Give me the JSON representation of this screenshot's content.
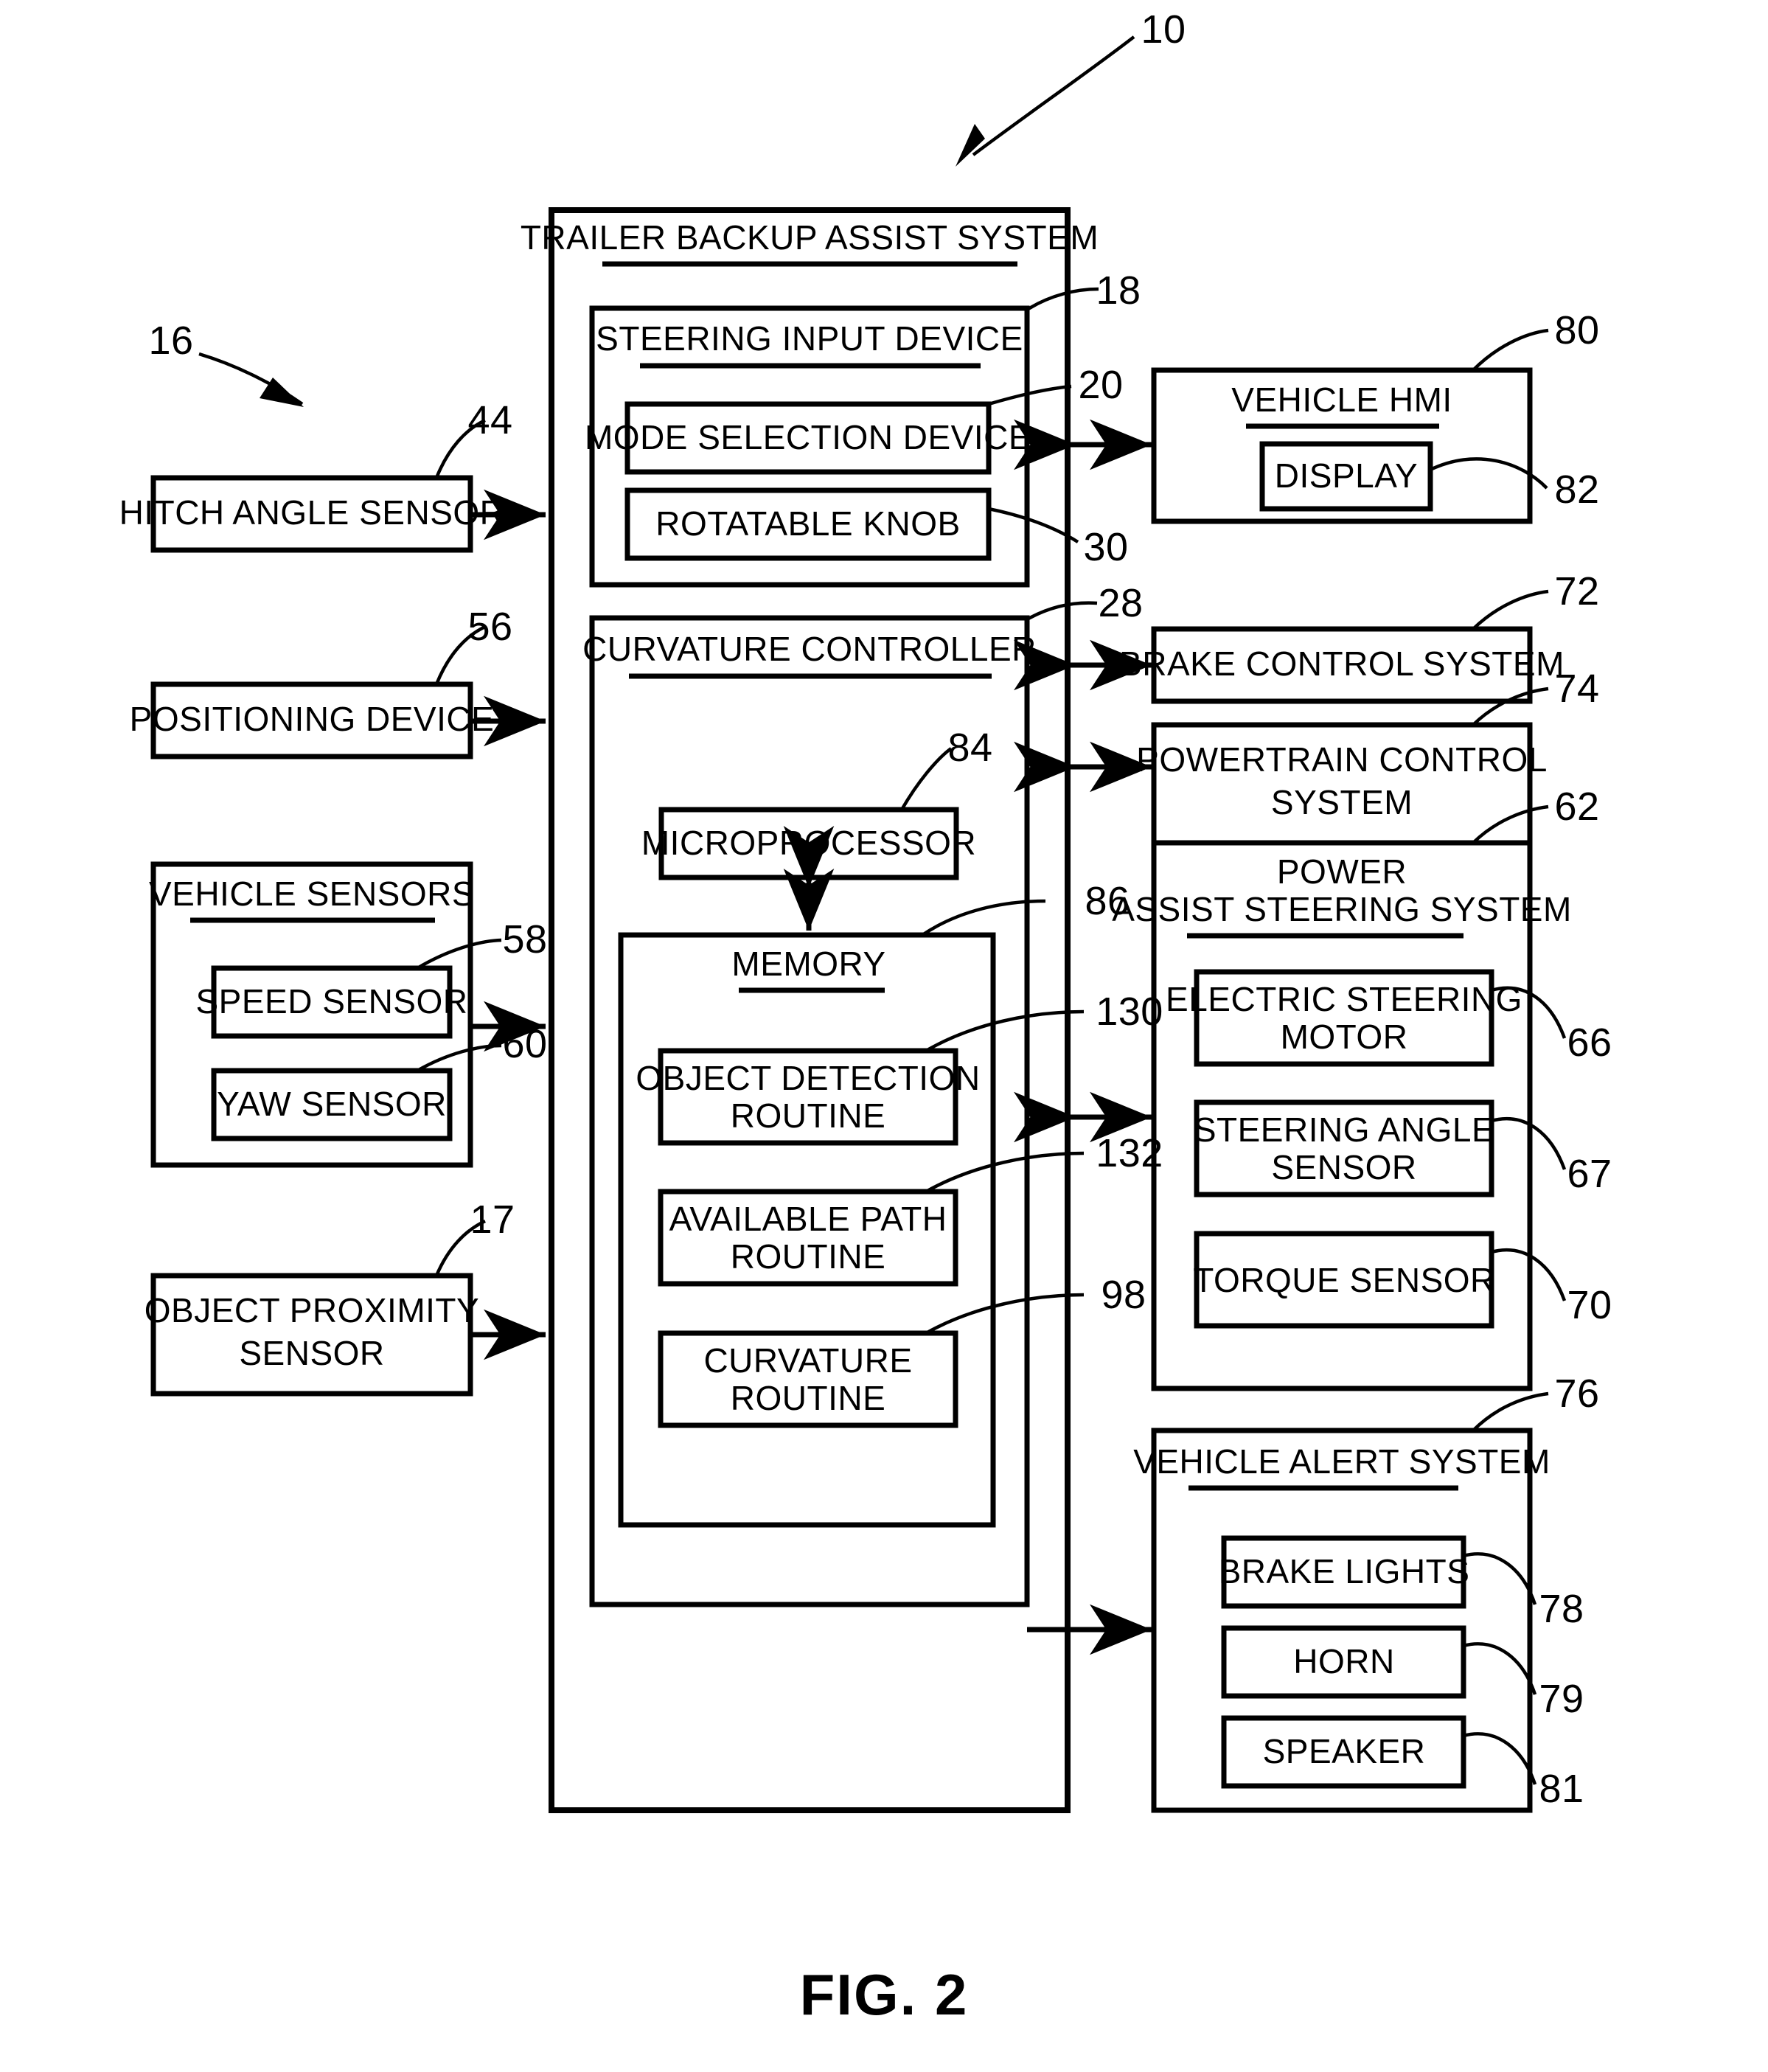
{
  "figure": {
    "caption": "FIG. 2",
    "system_ref": "10",
    "group_ref": "16"
  },
  "main_system": {
    "title": "TRAILER BACKUP ASSIST SYSTEM",
    "steering_input_device": {
      "title": "STEERING INPUT DEVICE",
      "ref": "18",
      "items": [
        {
          "label": "MODE SELECTION DEVICE",
          "ref": "20"
        },
        {
          "label": "ROTATABLE KNOB",
          "ref": "30"
        }
      ]
    },
    "curvature_controller": {
      "title": "CURVATURE CONTROLLER",
      "ref": "28",
      "microprocessor": {
        "label": "MICROPROCESSOR",
        "ref": "84"
      },
      "memory": {
        "title": "MEMORY",
        "ref": "86",
        "routines": [
          {
            "line1": "OBJECT DETECTION",
            "line2": "ROUTINE",
            "ref": "130"
          },
          {
            "line1": "AVAILABLE PATH",
            "line2": "ROUTINE",
            "ref": "132"
          },
          {
            "line1": "CURVATURE",
            "line2": "ROUTINE",
            "ref": "98"
          }
        ]
      }
    }
  },
  "left_inputs": [
    {
      "label": "HITCH ANGLE SENSOR",
      "ref": "44"
    },
    {
      "label": "POSITIONING DEVICE",
      "ref": "56"
    }
  ],
  "vehicle_sensors": {
    "title": "VEHICLE SENSORS",
    "items": [
      {
        "label": "SPEED SENSOR",
        "ref": "58"
      },
      {
        "label": "YAW SENSOR",
        "ref": "60"
      }
    ]
  },
  "object_proximity_sensor": {
    "line1": "OBJECT PROXIMITY",
    "line2": "SENSOR",
    "ref": "17"
  },
  "vehicle_hmi": {
    "title": "VEHICLE HMI",
    "ref": "80",
    "items": [
      {
        "label": "DISPLAY",
        "ref": "82"
      }
    ]
  },
  "brake_control_system": {
    "label": "BRAKE CONTROL SYSTEM",
    "ref": "72"
  },
  "powertrain_control_system": {
    "line1": "POWERTRAIN CONTROL",
    "line2": "SYSTEM",
    "ref": "74"
  },
  "power_assist_steering_system": {
    "title_line1": "POWER",
    "title_line2": "ASSIST STEERING SYSTEM",
    "ref": "62",
    "items": [
      {
        "line1": "ELECTRIC STEERING",
        "line2": "MOTOR",
        "ref": "66"
      },
      {
        "line1": "STEERING ANGLE",
        "line2": "SENSOR",
        "ref": "67"
      },
      {
        "line1": "TORQUE SENSOR",
        "line2": "",
        "ref": "70"
      }
    ]
  },
  "vehicle_alert_system": {
    "title": "VEHICLE ALERT SYSTEM",
    "ref": "76",
    "items": [
      {
        "label": "BRAKE LIGHTS",
        "ref": "78"
      },
      {
        "label": "HORN",
        "ref": "79"
      },
      {
        "label": "SPEAKER",
        "ref": "81"
      }
    ]
  }
}
